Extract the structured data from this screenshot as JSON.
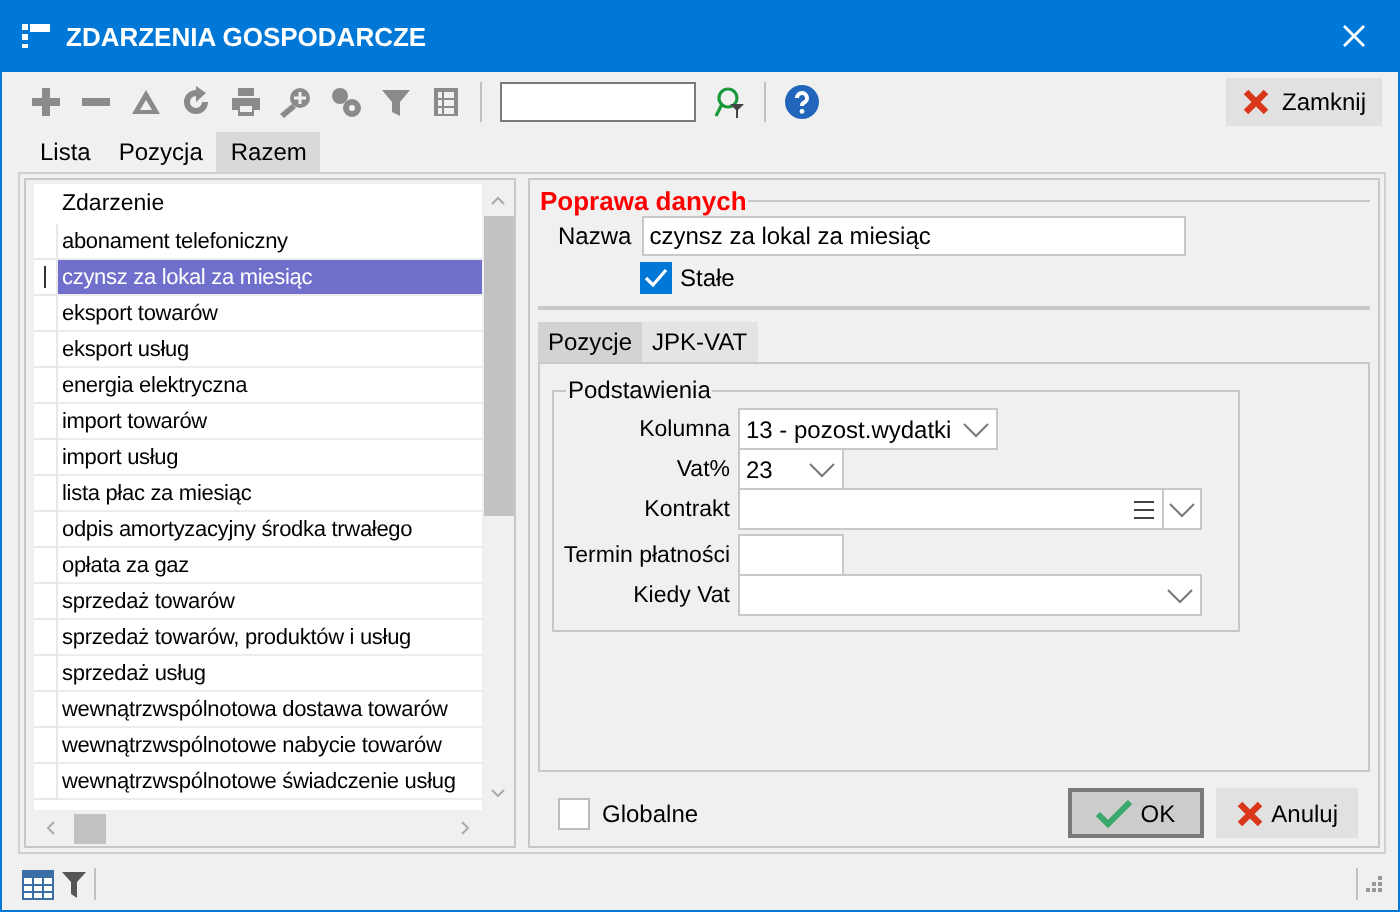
{
  "window": {
    "title": "ZDARZENIA GOSPODARCZE"
  },
  "toolbar": {
    "close_button": "Zamknij"
  },
  "tabs": [
    {
      "label": "Lista",
      "selected": false
    },
    {
      "label": "Pozycja",
      "selected": false
    },
    {
      "label": "Razem",
      "selected": true
    }
  ],
  "list": {
    "header": "Zdarzenie",
    "rows": [
      {
        "name": "abonament telefoniczny",
        "selected": false
      },
      {
        "name": "czynsz za lokal za miesiąc",
        "selected": true
      },
      {
        "name": "eksport towarów",
        "selected": false
      },
      {
        "name": "eksport usług",
        "selected": false
      },
      {
        "name": "energia elektryczna",
        "selected": false
      },
      {
        "name": "import towarów",
        "selected": false
      },
      {
        "name": "import usług",
        "selected": false
      },
      {
        "name": "lista płac za miesiąc",
        "selected": false
      },
      {
        "name": "odpis amortyzacyjny środka trwałego",
        "selected": false
      },
      {
        "name": "opłata za gaz",
        "selected": false
      },
      {
        "name": "sprzedaż towarów",
        "selected": false
      },
      {
        "name": "sprzedaż towarów, produktów i usług",
        "selected": false
      },
      {
        "name": "sprzedaż usług",
        "selected": false
      },
      {
        "name": "wewnątrzwspólnotowa dostawa towarów",
        "selected": false
      },
      {
        "name": "wewnątrzwspólnotowe nabycie towarów",
        "selected": false
      },
      {
        "name": "wewnątrzwspólnotowe świadczenie usług",
        "selected": false
      }
    ]
  },
  "form": {
    "title": "Poprawa danych",
    "name_label": "Nazwa",
    "name_value": "czynsz za lokal za miesiąc",
    "fixed": {
      "label": "Stałe",
      "checked": true
    },
    "tabs": [
      {
        "label": "Pozycje",
        "selected": true
      },
      {
        "label": "JPK-VAT",
        "selected": false
      }
    ],
    "group": {
      "title": "Podstawienia",
      "fields": [
        {
          "kind": "combo",
          "label": "Kolumna",
          "value": "13 - pozost.wydatki"
        },
        {
          "kind": "combo",
          "label": "Vat%",
          "value": "23"
        },
        {
          "kind": "lookup",
          "label": "Kontrakt"
        },
        {
          "kind": "text",
          "label": "Termin płatności"
        },
        {
          "kind": "combo",
          "label": "Kiedy Vat"
        }
      ]
    },
    "global": {
      "label": "Globalne",
      "checked": false
    },
    "buttons": [
      {
        "kind": "ok",
        "label": "OK",
        "default": true
      },
      {
        "kind": "cancel",
        "label": "Anuluj",
        "default": false
      }
    ]
  }
}
